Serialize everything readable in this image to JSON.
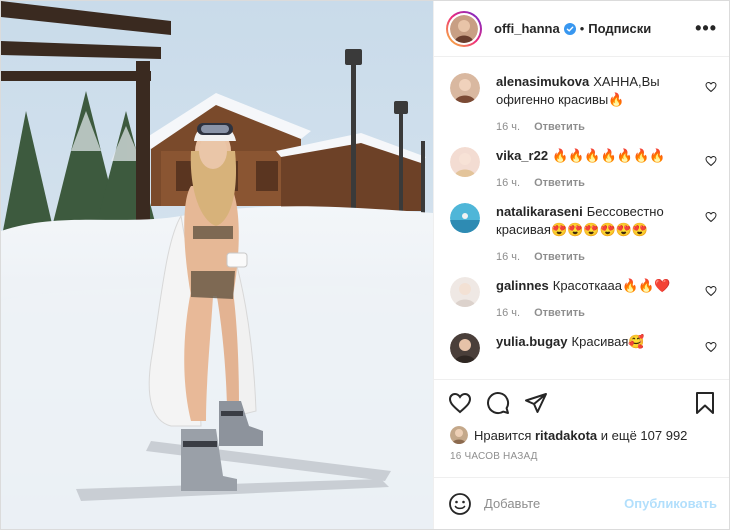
{
  "post": {
    "username": "offi_hanna",
    "separator": "•",
    "follow_label": "Подписки",
    "more_label": "•••"
  },
  "comments": [
    {
      "user": "alenasimukova",
      "text": "ХАННА,Вы офигенно красивы🔥",
      "time": "16 ч.",
      "reply": "Ответить"
    },
    {
      "user": "vika_r22",
      "text": "🔥🔥🔥🔥🔥🔥🔥",
      "time": "16 ч.",
      "reply": "Ответить"
    },
    {
      "user": "natalikaraseni",
      "text": "Бессовестно красивая😍😍😍😍😍😍",
      "time": "16 ч.",
      "reply": "Ответить"
    },
    {
      "user": "galinnes",
      "text": "Красоткааа🔥🔥❤️",
      "time": "16 ч.",
      "reply": "Ответить"
    },
    {
      "user": "yulia.bugay",
      "text": "Красивая🥰",
      "time": "",
      "reply": ""
    }
  ],
  "likes": {
    "prefix": "Нравится",
    "user": "ritadakota",
    "suffix": "и ещё 107 992"
  },
  "timestamp": "16 ЧАСОВ НАЗАД",
  "add_comment": {
    "placeholder": "Добавьте",
    "publish_label": "Опубликовать"
  },
  "colors": {
    "verified": "#3897f0",
    "publish_disabled": "#b2dffc",
    "muted": "#8e8e8e"
  },
  "icons": [
    "verified-icon",
    "heart-icon",
    "comment-icon",
    "share-icon",
    "bookmark-icon",
    "emoji-icon"
  ]
}
